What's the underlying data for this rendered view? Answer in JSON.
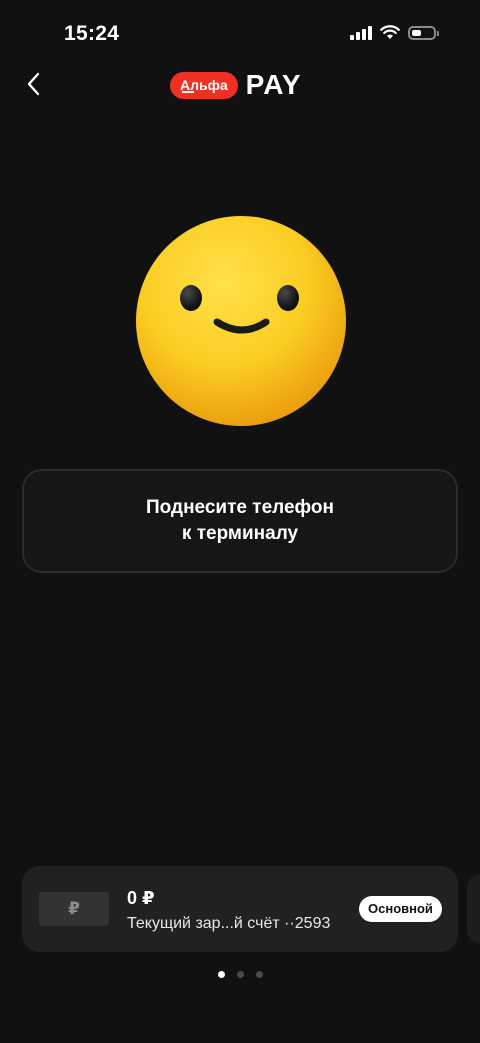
{
  "status_bar": {
    "time": "15:24",
    "battery_level": 0.45
  },
  "header": {
    "logo_badge": "Альфа",
    "logo_text": "PAY"
  },
  "emoji": {
    "icon": "smiling-face-icon",
    "colors": {
      "face": "#f7c71e",
      "eyes": "#1a1a1a"
    }
  },
  "instruction": {
    "line1": "Поднесите телефон",
    "line2": "к терминалу"
  },
  "account_card": {
    "currency_symbol": "₽",
    "balance": "0 ₽",
    "name": "Текущий зар...й счёт ··2593",
    "badge": "Основной"
  },
  "pagination": {
    "total": 3,
    "active_index": 0
  },
  "colors": {
    "background": "#111111",
    "brand_red": "#ef3124",
    "card": "#212121"
  }
}
